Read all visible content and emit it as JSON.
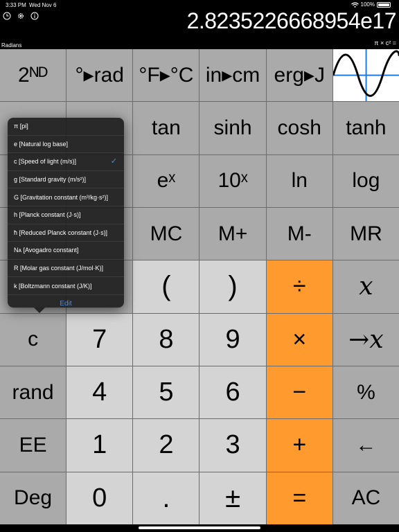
{
  "status": {
    "time": "3:33 PM",
    "date": "Wed Nov 6",
    "battery": "100%"
  },
  "display": {
    "value": "2.8235226668954e17",
    "mode": "Radians",
    "memory_label": "π × c² ="
  },
  "keys": [
    {
      "label": "2ᴺᴰ",
      "kind": "fn"
    },
    {
      "label": "°▸rad",
      "kind": "fn"
    },
    {
      "label": "°F▸°C",
      "kind": "fn"
    },
    {
      "label": "in▸cm",
      "kind": "fn"
    },
    {
      "label": "erg▸J",
      "kind": "fn"
    },
    {
      "label": "",
      "kind": "graph"
    },
    {
      "label": "",
      "kind": "hidden"
    },
    {
      "label": "",
      "kind": "hidden"
    },
    {
      "label": "tan",
      "kind": "fn"
    },
    {
      "label": "sinh",
      "kind": "fn"
    },
    {
      "label": "cosh",
      "kind": "fn"
    },
    {
      "label": "tanh",
      "kind": "fn"
    },
    {
      "label": "",
      "kind": "hidden"
    },
    {
      "label": "",
      "kind": "hidden"
    },
    {
      "label": "eˣ",
      "kind": "fn"
    },
    {
      "label": "10ˣ",
      "kind": "fn"
    },
    {
      "label": "ln",
      "kind": "fn"
    },
    {
      "label": "log",
      "kind": "fn"
    },
    {
      "label": "",
      "kind": "hidden"
    },
    {
      "label": "",
      "kind": "hidden"
    },
    {
      "label": "MC",
      "kind": "fn"
    },
    {
      "label": "M+",
      "kind": "fn"
    },
    {
      "label": "M-",
      "kind": "fn"
    },
    {
      "label": "MR",
      "kind": "fn"
    },
    {
      "label": "",
      "kind": "hidden"
    },
    {
      "label": "",
      "kind": "hidden"
    },
    {
      "label": "(",
      "kind": "num"
    },
    {
      "label": ")",
      "kind": "num"
    },
    {
      "label": "÷",
      "kind": "op"
    },
    {
      "label": "x",
      "kind": "italic"
    },
    {
      "label": "c",
      "kind": "fn"
    },
    {
      "label": "7",
      "kind": "num"
    },
    {
      "label": "8",
      "kind": "num"
    },
    {
      "label": "9",
      "kind": "num"
    },
    {
      "label": "×",
      "kind": "op"
    },
    {
      "label": "→x",
      "kind": "italic"
    },
    {
      "label": "rand",
      "kind": "fn"
    },
    {
      "label": "4",
      "kind": "num"
    },
    {
      "label": "5",
      "kind": "num"
    },
    {
      "label": "6",
      "kind": "num"
    },
    {
      "label": "−",
      "kind": "op"
    },
    {
      "label": "%",
      "kind": "fn"
    },
    {
      "label": "EE",
      "kind": "fn"
    },
    {
      "label": "1",
      "kind": "num"
    },
    {
      "label": "2",
      "kind": "num"
    },
    {
      "label": "3",
      "kind": "num"
    },
    {
      "label": "+",
      "kind": "op"
    },
    {
      "label": "←",
      "kind": "fn"
    },
    {
      "label": "Deg",
      "kind": "fn"
    },
    {
      "label": "0",
      "kind": "num"
    },
    {
      "label": ".",
      "kind": "num"
    },
    {
      "label": "±",
      "kind": "num"
    },
    {
      "label": "=",
      "kind": "op"
    },
    {
      "label": "AC",
      "kind": "fn"
    }
  ],
  "constants_menu": {
    "items": [
      {
        "label": "π [pi]",
        "checked": false
      },
      {
        "label": "e [Natural log base]",
        "checked": false
      },
      {
        "label": "c [Speed of light (m/s)]",
        "checked": true
      },
      {
        "label": "g [Standard gravity (m/s²)]",
        "checked": false
      },
      {
        "label": "G [Gravitation constant (m³/kg·s²)]",
        "checked": false
      },
      {
        "label": "h [Planck constant (J·s)]",
        "checked": false
      },
      {
        "label": "ħ [Reduced Planck constant (J·s)]",
        "checked": false
      },
      {
        "label": "Nᴀ [Avogadro constant]",
        "checked": false
      },
      {
        "label": "R [Molar gas constant (J/mol·K)]",
        "checked": false
      },
      {
        "label": "k [Boltzmann constant (J/K)]",
        "checked": false
      }
    ],
    "edit_label": "Edit",
    "check_mark": "✓"
  },
  "colors": {
    "key": "#aaaaaa",
    "number_key": "#d4d4d4",
    "operator_key": "#fe9a2e",
    "accent": "#4a90e2"
  }
}
